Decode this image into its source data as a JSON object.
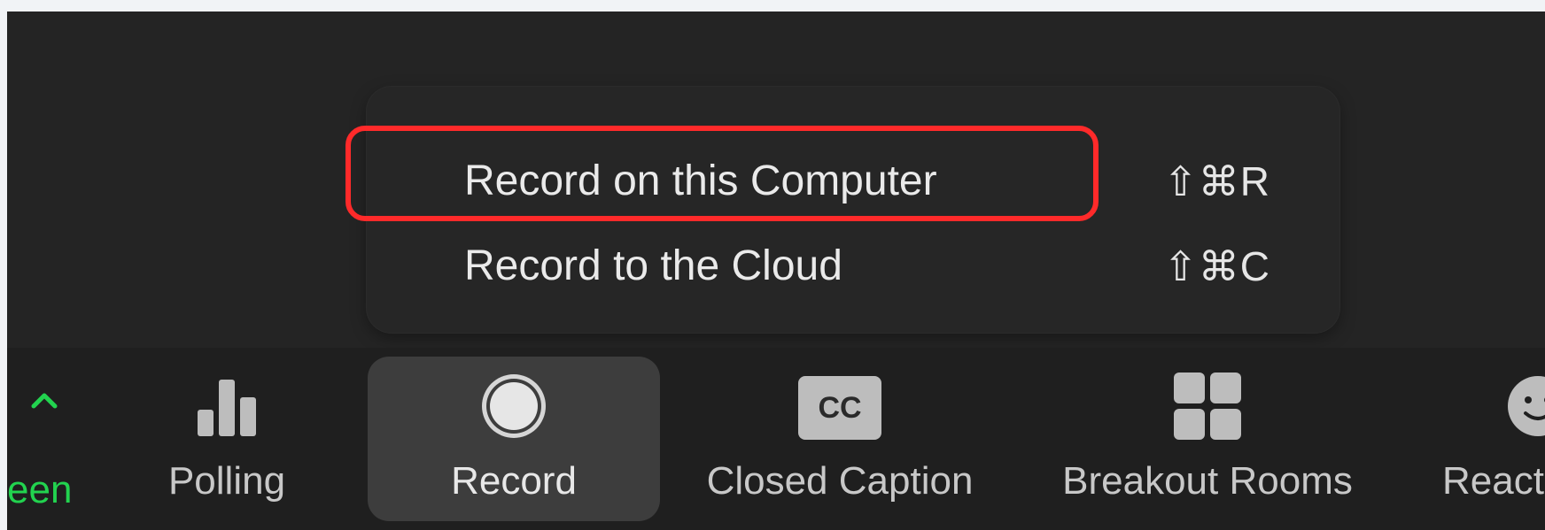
{
  "menu": {
    "items": [
      {
        "label": "Record on this Computer",
        "shortcut": "⇧⌘R",
        "highlighted": true
      },
      {
        "label": "Record to the Cloud",
        "shortcut": "⇧⌘C",
        "highlighted": false
      }
    ]
  },
  "toolbar": {
    "share_screen_partial_label": "een",
    "items": [
      {
        "label": "Polling",
        "icon": "bar-chart-icon"
      },
      {
        "label": "Record",
        "icon": "record-icon",
        "active": true
      },
      {
        "label": "Closed Caption",
        "icon": "closed-caption-icon",
        "icon_text": "CC"
      },
      {
        "label": "Breakout Rooms",
        "icon": "breakout-rooms-icon"
      },
      {
        "label": "React",
        "icon": "reaction-smiley-icon"
      }
    ]
  },
  "colors": {
    "background": "#242424",
    "toolbar": "#1f1f1f",
    "highlight": "#ff2a2a",
    "share_green": "#22d34f"
  }
}
